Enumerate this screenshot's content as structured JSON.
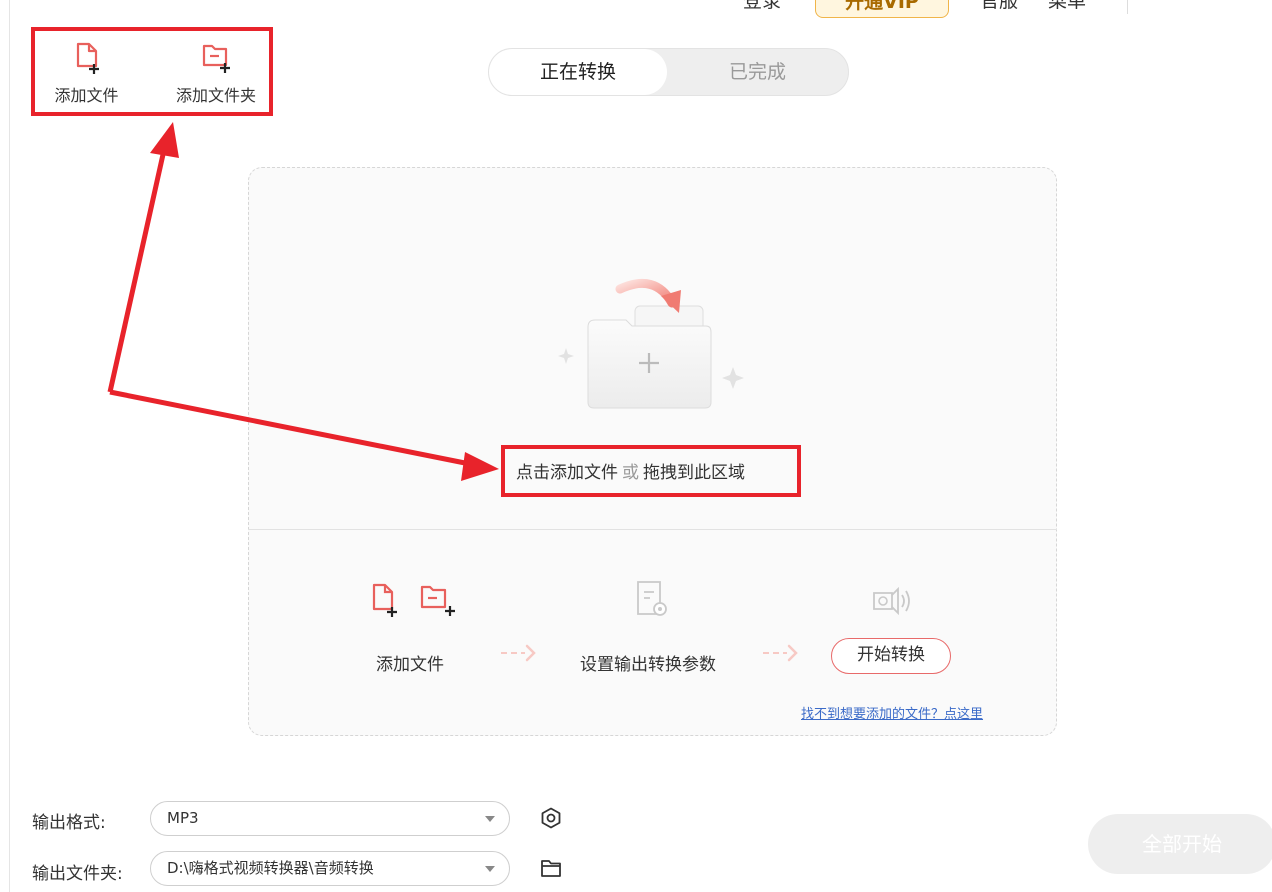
{
  "topbar": {
    "login": "登录",
    "vip": "开通VIP",
    "official": "官服",
    "menu": "菜单"
  },
  "toolbar": {
    "add_file": "添加文件",
    "add_folder": "添加文件夹"
  },
  "tabs": {
    "active": "正在转换",
    "inactive": "已完成"
  },
  "drop": {
    "add_text": "点击添加文件",
    "or_text": "或",
    "drag_text": "拖拽到此区域"
  },
  "steps": {
    "step1": "添加文件",
    "step2": "设置输出转换参数",
    "start_button": "开始转换"
  },
  "help_link": "找不到想要添加的文件？点这里",
  "output": {
    "format_label": "输出格式:",
    "format_value": "MP3",
    "folder_label": "输出文件夹:",
    "folder_value": "D:\\嗨格式视频转换器\\音频转换"
  },
  "start_all": "全部开始",
  "colors": {
    "accent_red": "#e8232b",
    "icon_red": "#e8605c",
    "link_blue": "#3a6ac8"
  }
}
